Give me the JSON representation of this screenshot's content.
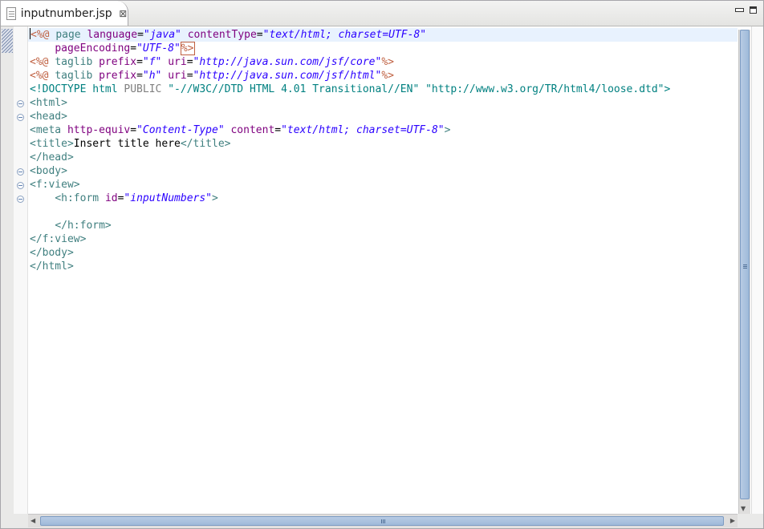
{
  "tab": {
    "title": "inputnumber.jsp",
    "close_glyph": "⊠"
  },
  "editor": {
    "lines": [
      {
        "segs": [
          [
            "d",
            "<%@ "
          ],
          [
            "t",
            "page "
          ],
          [
            "a",
            "language"
          ],
          [
            "e",
            "="
          ],
          [
            "v",
            "\"java\""
          ],
          [
            "e",
            " "
          ],
          [
            "a",
            "contentType"
          ],
          [
            "e",
            "="
          ],
          [
            "v",
            "\"text/html; charset=UTF-8\""
          ]
        ]
      },
      {
        "segs": [
          [
            "e",
            "    "
          ],
          [
            "a",
            "pageEncoding"
          ],
          [
            "e",
            "="
          ],
          [
            "v",
            "\"UTF-8\""
          ],
          [
            "d",
            "%>"
          ]
        ]
      },
      {
        "segs": [
          [
            "d",
            "<%@ "
          ],
          [
            "t",
            "taglib "
          ],
          [
            "a",
            "prefix"
          ],
          [
            "e",
            "="
          ],
          [
            "v",
            "\"f\""
          ],
          [
            "e",
            " "
          ],
          [
            "a",
            "uri"
          ],
          [
            "e",
            "="
          ],
          [
            "v",
            "\"http://java.sun.com/jsf/core\""
          ],
          [
            "d",
            "%>"
          ]
        ]
      },
      {
        "segs": [
          [
            "d",
            "<%@ "
          ],
          [
            "t",
            "taglib "
          ],
          [
            "a",
            "prefix"
          ],
          [
            "e",
            "="
          ],
          [
            "v",
            "\"h\""
          ],
          [
            "e",
            " "
          ],
          [
            "a",
            "uri"
          ],
          [
            "e",
            "="
          ],
          [
            "v",
            "\"http://java.sun.com/jsf/html\""
          ],
          [
            "d",
            "%>"
          ]
        ]
      },
      {
        "segs": [
          [
            "c",
            "<!DOCTYPE html "
          ],
          [
            "g",
            "PUBLIC "
          ],
          [
            "c",
            "\"-//W3C//DTD HTML 4.01 Transitional//EN\" \"http://www.w3.org/TR/html4/loose.dtd\">"
          ]
        ]
      },
      {
        "segs": [
          [
            "t",
            "<html>"
          ]
        ]
      },
      {
        "segs": [
          [
            "t",
            "<head>"
          ]
        ]
      },
      {
        "segs": [
          [
            "t",
            "<meta "
          ],
          [
            "a",
            "http-equiv"
          ],
          [
            "e",
            "="
          ],
          [
            "v",
            "\"Content-Type\""
          ],
          [
            "e",
            " "
          ],
          [
            "a",
            "content"
          ],
          [
            "e",
            "="
          ],
          [
            "v",
            "\"text/html; charset=UTF-8\""
          ],
          [
            "t",
            ">"
          ]
        ]
      },
      {
        "segs": [
          [
            "t",
            "<title>"
          ],
          [
            "x",
            "Insert title here"
          ],
          [
            "t",
            "</title>"
          ]
        ]
      },
      {
        "segs": [
          [
            "t",
            "</head>"
          ]
        ]
      },
      {
        "segs": [
          [
            "t",
            "<body>"
          ]
        ]
      },
      {
        "segs": [
          [
            "t",
            "<f:view>"
          ]
        ]
      },
      {
        "segs": [
          [
            "e",
            "    "
          ],
          [
            "t",
            "<h:form "
          ],
          [
            "a",
            "id"
          ],
          [
            "e",
            "="
          ],
          [
            "v",
            "\"inputNumbers\""
          ],
          [
            "t",
            ">"
          ]
        ]
      },
      {
        "segs": []
      },
      {
        "segs": [
          [
            "e",
            "    "
          ],
          [
            "t",
            "</h:form>"
          ]
        ]
      },
      {
        "segs": [
          [
            "t",
            "</f:view>"
          ]
        ]
      },
      {
        "segs": [
          [
            "t",
            "</body>"
          ]
        ]
      },
      {
        "segs": [
          [
            "t",
            "</html>"
          ]
        ]
      }
    ]
  }
}
